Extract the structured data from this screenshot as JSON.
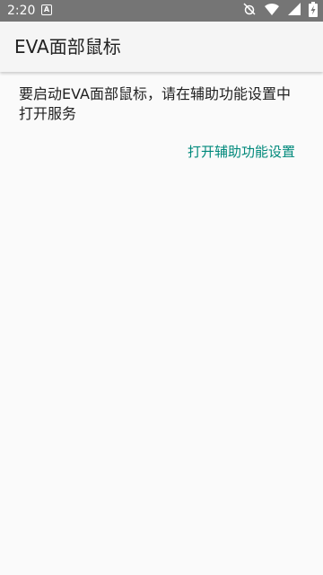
{
  "status_bar": {
    "time": "2:20",
    "notification_badge": "A",
    "icons": [
      "alarm-off-icon",
      "wifi-icon",
      "signal-icon",
      "battery-charging-icon"
    ]
  },
  "app_bar": {
    "title": "EVA面部鼠标"
  },
  "main": {
    "message": "要启动EVA面部鼠标，请在辅助功能设置中打开服务",
    "open_settings_label": "打开辅助功能设置"
  },
  "colors": {
    "status_bar": "#757575",
    "app_bar": "#f5f5f5",
    "background": "#fafafa",
    "accent": "#00897b",
    "text": "#212121"
  }
}
